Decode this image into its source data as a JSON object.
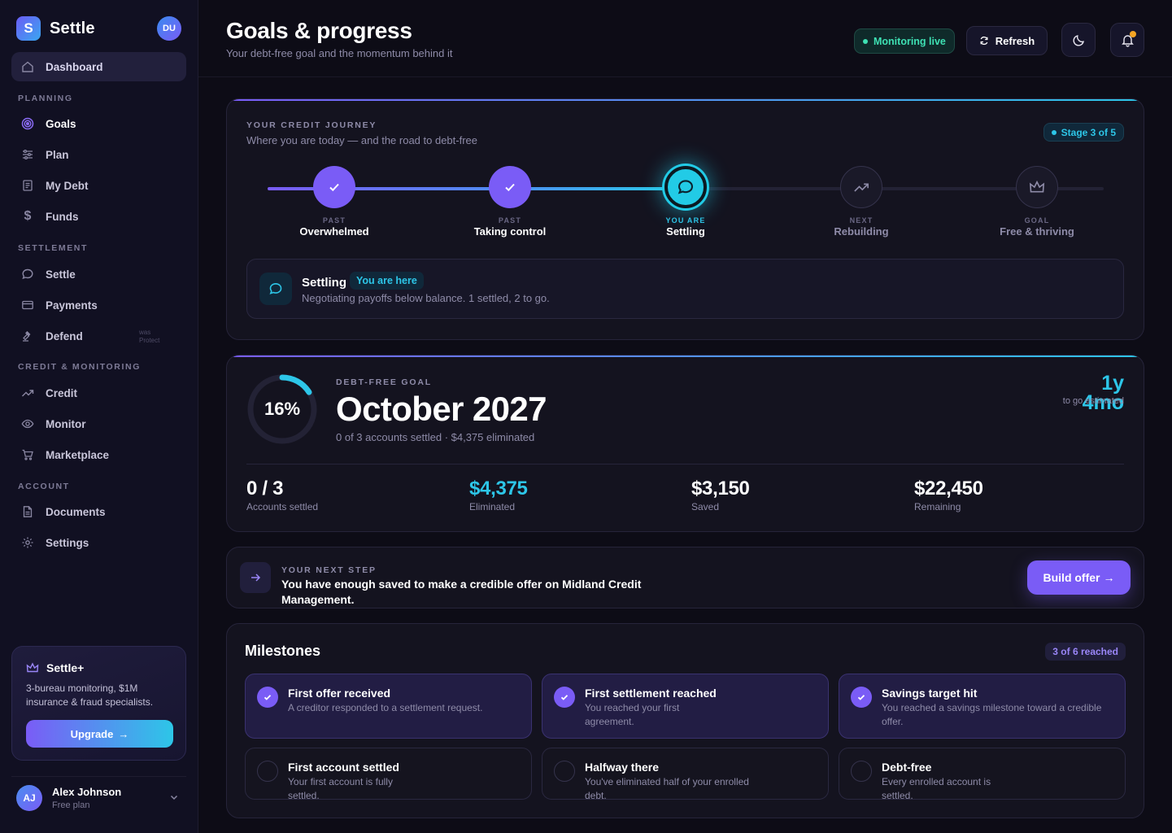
{
  "app": {
    "name": "Settle",
    "logo_letter": "S",
    "header_avatar": "DU"
  },
  "colors": {
    "accent": "#7a5cf6",
    "cyan": "#2dc6e8",
    "live": "#3ee0b3",
    "notification": "#f5a524",
    "background": "#0d0c16"
  },
  "sidebar": {
    "dashboard": "Dashboard",
    "sections": {
      "planning": "PLANNING",
      "settlement": "SETTLEMENT",
      "credit": "CREDIT & MONITORING",
      "account": "ACCOUNT"
    },
    "items": {
      "goals": "Goals",
      "plan": "Plan",
      "my_debt": "My Debt",
      "funds": "Funds",
      "settle": "Settle",
      "payments": "Payments",
      "defend": "Defend",
      "defend_sub": "was Protect",
      "credit": "Credit",
      "monitor": "Monitor",
      "marketplace": "Marketplace",
      "documents": "Documents",
      "settings": "Settings"
    },
    "promo": {
      "title": "Settle+",
      "desc": "3-bureau monitoring, $1M insurance & fraud specialists.",
      "button": "Upgrade"
    },
    "user": {
      "initials": "AJ",
      "name": "Alex Johnson",
      "plan": "Free plan"
    }
  },
  "header": {
    "title": "Goals & progress",
    "subtitle": "Your debt-free goal and the momentum behind it",
    "live": "Monitoring live",
    "refresh": "Refresh"
  },
  "journey": {
    "eyebrow": "YOUR CREDIT JOURNEY",
    "desc": "Where you are today — and the road to debt-free",
    "stage": "Stage 3 of 5",
    "steps": [
      {
        "kicker": "PAST",
        "label": "Overwhelmed"
      },
      {
        "kicker": "PAST",
        "label": "Taking control"
      },
      {
        "kicker": "YOU ARE",
        "label": "Settling"
      },
      {
        "kicker": "NEXT",
        "label": "Rebuilding"
      },
      {
        "kicker": "GOAL",
        "label": "Free & thriving"
      }
    ],
    "status_title": "Settling",
    "status_pill": "You are here",
    "status_desc": "Negotiating payoffs below balance. 1 settled, 2 to go."
  },
  "goal": {
    "percent": "16%",
    "percent_value": 16,
    "eyebrow": "DEBT-FREE GOAL",
    "date": "October 2027",
    "sub": "0 of 3 accounts settled · $4,375 eliminated",
    "togo": "1y 4mo",
    "togo_label": "to go estimated",
    "stats": [
      {
        "value": "0 / 3",
        "label": "Accounts settled"
      },
      {
        "value": "$4,375",
        "label": "Eliminated"
      },
      {
        "value": "$3,150",
        "label": "Saved"
      },
      {
        "value": "$22,450",
        "label": "Remaining"
      }
    ]
  },
  "next_step": {
    "eyebrow": "YOUR NEXT STEP",
    "text": "You have enough saved to make a credible offer on Midland Credit Management.",
    "button": "Build offer"
  },
  "milestones": {
    "title": "Milestones",
    "count": "3 of 6 reached",
    "items": [
      {
        "name": "First offer received",
        "desc": "A creditor responded to a settlement request.",
        "reached": true
      },
      {
        "name": "First settlement reached",
        "desc": "You reached your first agreement.",
        "reached": true
      },
      {
        "name": "Savings target hit",
        "desc": "You reached a savings milestone toward a credible offer.",
        "reached": true
      },
      {
        "name": "First account settled",
        "desc": "Your first account is fully settled.",
        "reached": false
      },
      {
        "name": "Halfway there",
        "desc": "You've eliminated half of your enrolled debt.",
        "reached": false
      },
      {
        "name": "Debt-free",
        "desc": "Every enrolled account is settled.",
        "reached": false
      }
    ]
  }
}
